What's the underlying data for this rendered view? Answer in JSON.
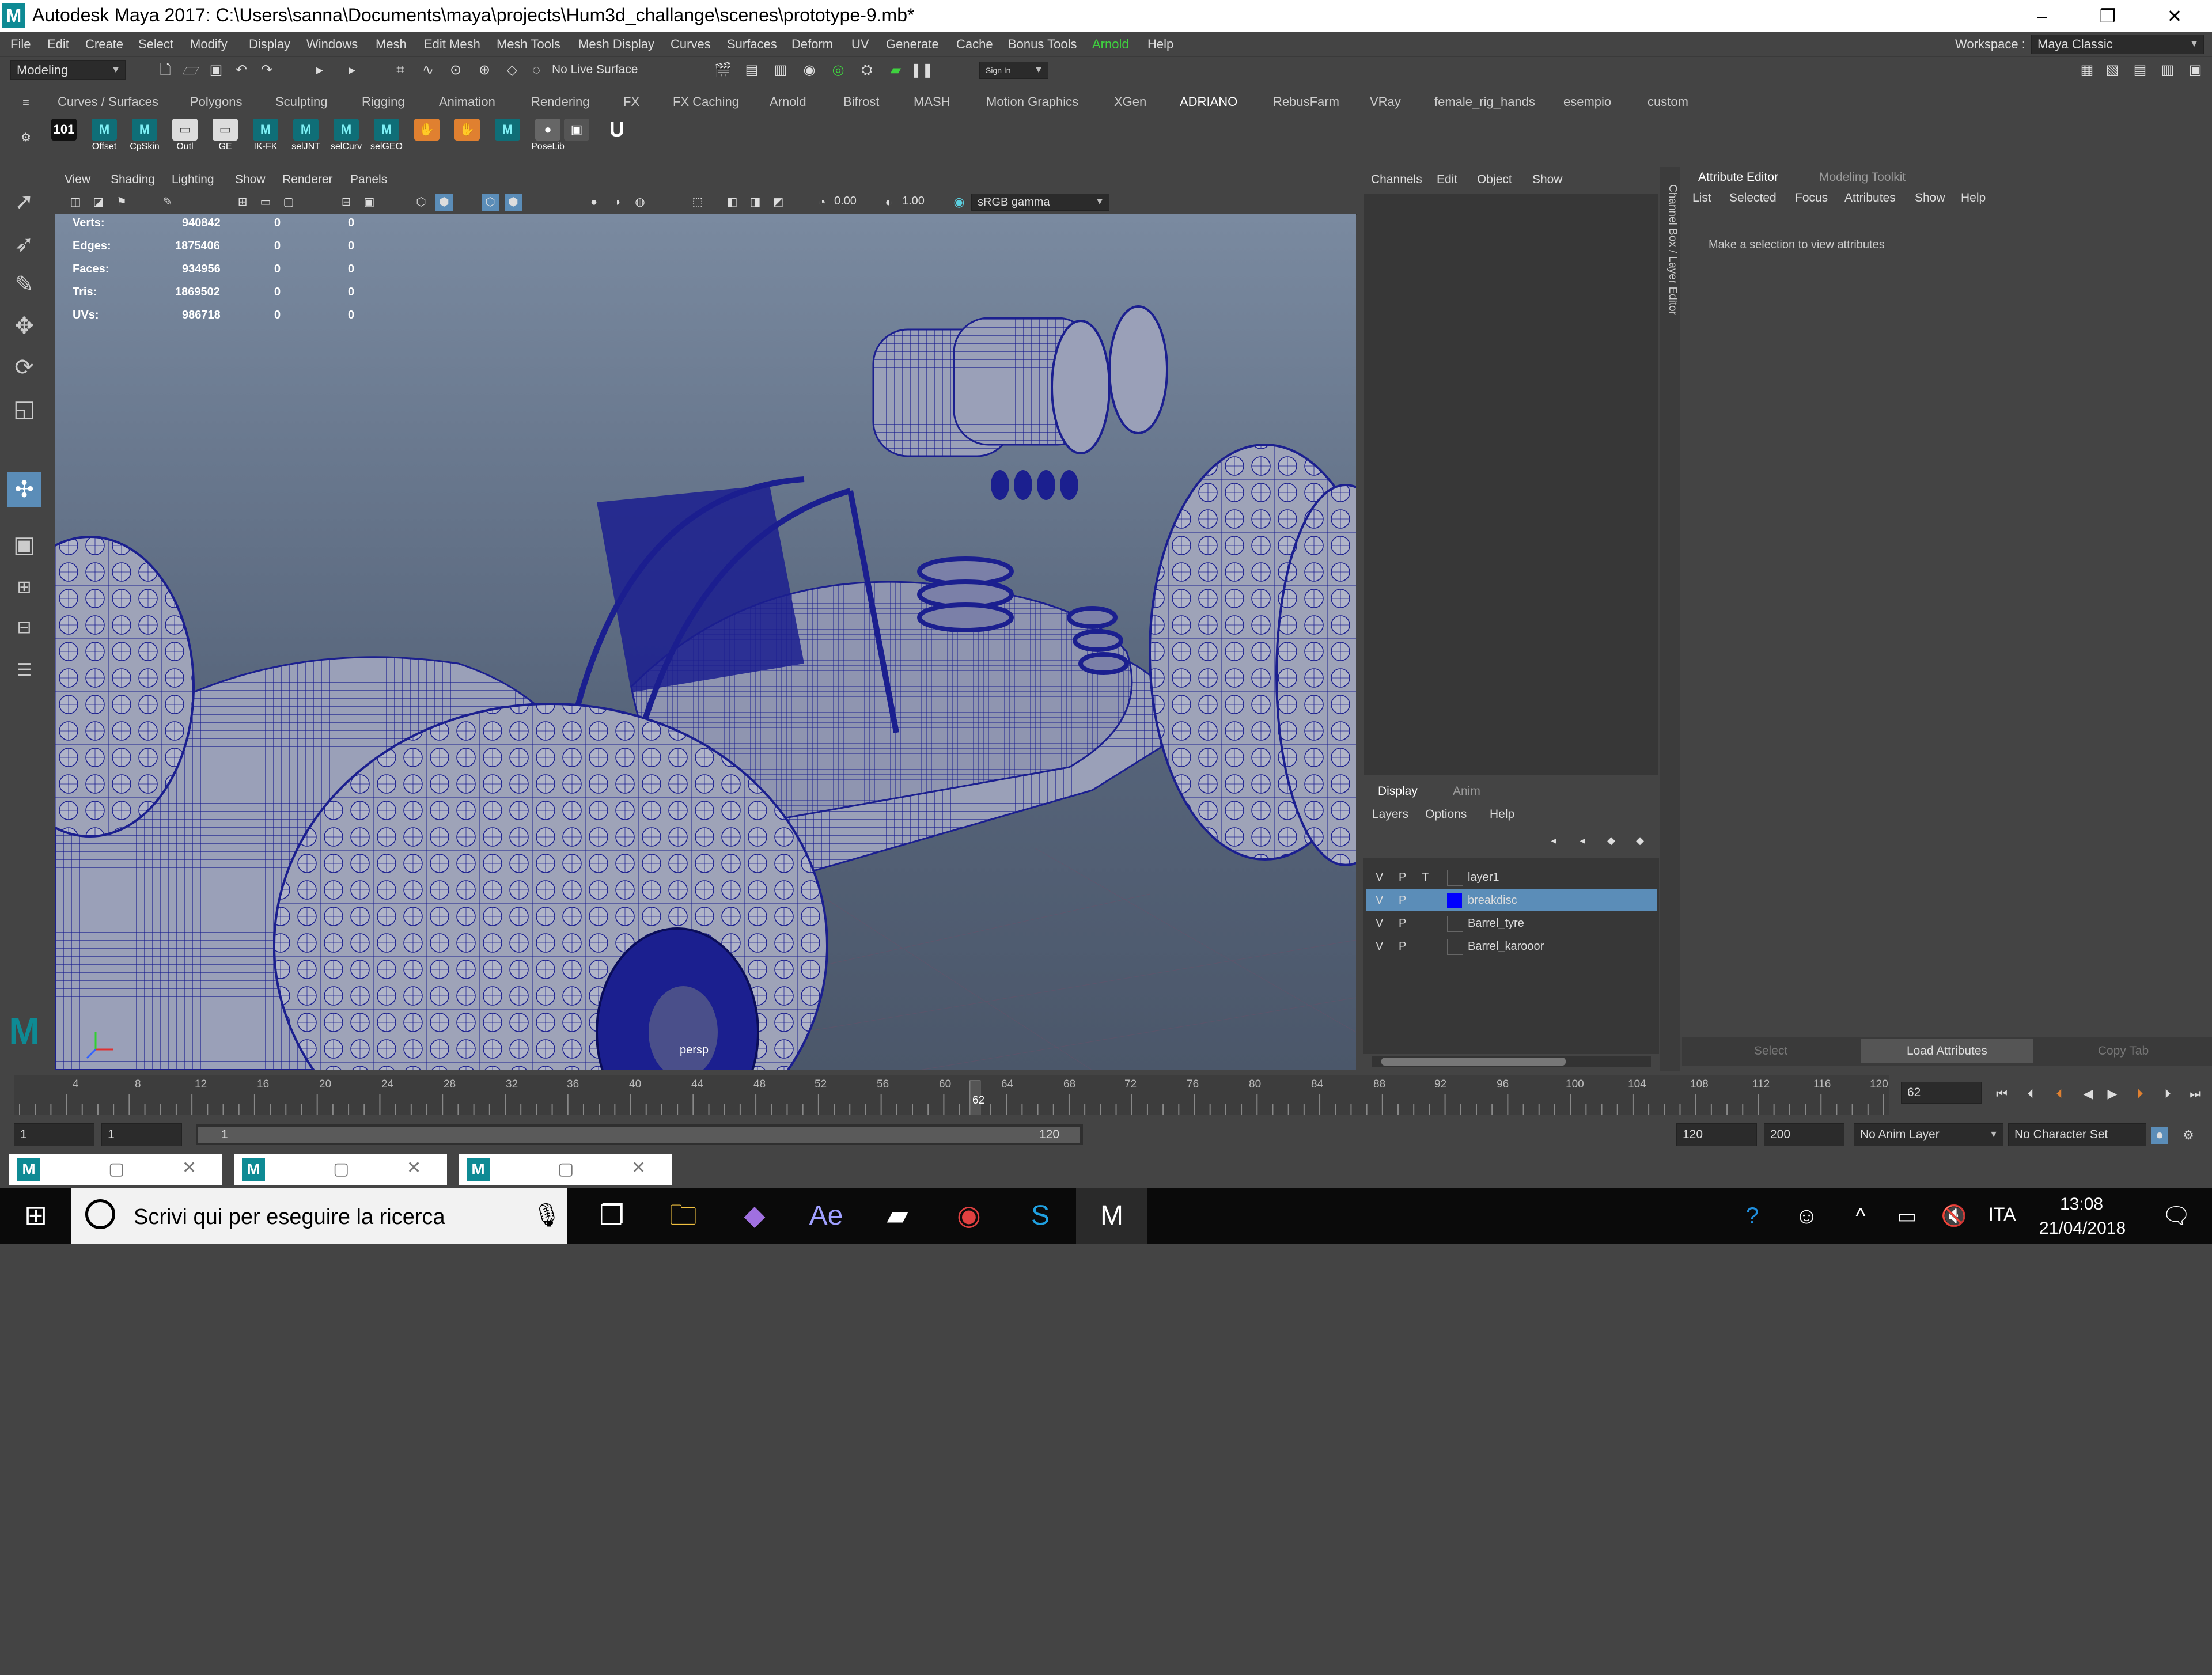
{
  "window": {
    "logo": "M",
    "title": "Autodesk Maya 2017: C:\\Users\\sanna\\Documents\\maya\\projects\\Hum3d_challange\\scenes\\prototype-9.mb*",
    "minimize": "–",
    "maximize": "❐",
    "close": "✕"
  },
  "menubar": {
    "items": [
      "File",
      "Edit",
      "Create",
      "Select",
      "Modify",
      "Display",
      "Windows",
      "Mesh",
      "Edit Mesh",
      "Mesh Tools",
      "Mesh Display",
      "Curves",
      "Surfaces",
      "Deform",
      "UV",
      "Generate",
      "Cache",
      "Bonus Tools",
      "Arnold",
      "Help"
    ],
    "workspace_label": "Workspace :",
    "workspace_value": "Maya Classic"
  },
  "statusline": {
    "mode": "Modeling",
    "live_surface": "No Live Surface",
    "sign_in": "Sign In"
  },
  "shelf": {
    "tabs": [
      "Curves / Surfaces",
      "Polygons",
      "Sculpting",
      "Rigging",
      "Animation",
      "Rendering",
      "FX",
      "FX Caching",
      "Arnold",
      "Bifrost",
      "MASH",
      "Motion Graphics",
      "XGen",
      "ADRIANO",
      "RebusFarm",
      "VRay",
      "female_rig_hands",
      "esempio",
      "custom"
    ],
    "active_tab": "ADRIANO",
    "buttons": [
      "",
      "Offset",
      "CpSkin",
      "Outl",
      "GE",
      "IK-FK",
      "selJNT",
      "selCurv",
      "selGEO",
      "",
      "",
      "",
      "",
      "PoseLib",
      ""
    ]
  },
  "viewport": {
    "menu": [
      "View",
      "Shading",
      "Lighting",
      "Show",
      "Renderer",
      "Panels"
    ],
    "exposure": "0.00",
    "gamma": "1.00",
    "colorspace": "sRGB gamma",
    "camera_label": "persp",
    "hud": [
      {
        "label": "Verts:",
        "v1": "940842",
        "v2": "0",
        "v3": "0"
      },
      {
        "label": "Edges:",
        "v1": "1875406",
        "v2": "0",
        "v3": "0"
      },
      {
        "label": "Faces:",
        "v1": "934956",
        "v2": "0",
        "v3": "0"
      },
      {
        "label": "Tris:",
        "v1": "1869502",
        "v2": "0",
        "v3": "0"
      },
      {
        "label": "UVs:",
        "v1": "986718",
        "v2": "0",
        "v3": "0"
      }
    ]
  },
  "channelbox": {
    "menu": [
      "Channels",
      "Edit",
      "Object",
      "Show"
    ],
    "strip_label": "Channel Box / Layer Editor",
    "layer_tabs": [
      "Display",
      "Anim"
    ],
    "layer_menu": [
      "Layers",
      "Options",
      "Help"
    ],
    "layers": [
      {
        "v": "V",
        "p": "P",
        "t": "T",
        "name": "layer1",
        "color": "",
        "selected": false
      },
      {
        "v": "V",
        "p": "P",
        "t": "",
        "name": "breakdisc",
        "color": "#0000ff",
        "selected": true
      },
      {
        "v": "V",
        "p": "P",
        "t": "",
        "name": "Barrel_tyre",
        "color": "",
        "selected": false
      },
      {
        "v": "V",
        "p": "P",
        "t": "",
        "name": "Barrel_karooor",
        "color": "",
        "selected": false
      }
    ]
  },
  "attribute_editor": {
    "tabs": [
      "Attribute Editor",
      "Modeling Toolkit"
    ],
    "menu": [
      "List",
      "Selected",
      "Focus",
      "Attributes",
      "Show",
      "Help"
    ],
    "message": "Make a selection to view attributes",
    "buttons": [
      "Select",
      "Load Attributes",
      "Copy Tab"
    ]
  },
  "timeslider": {
    "ticks": [
      "4",
      "8",
      "12",
      "16",
      "20",
      "24",
      "28",
      "32",
      "36",
      "40",
      "44",
      "48",
      "52",
      "56",
      "60",
      "64",
      "68",
      "72",
      "76",
      "80",
      "84",
      "88",
      "92",
      "96",
      "100",
      "104",
      "108",
      "112",
      "116",
      "120"
    ],
    "current_frame": "62",
    "current_frame_field": "62"
  },
  "rangeslider": {
    "start": "1",
    "start2": "1",
    "range_start": "1",
    "range_end": "120",
    "end": "120",
    "end2": "200",
    "anim_layer": "No Anim Layer",
    "character_set": "No Character Set"
  },
  "taskbar": {
    "search_placeholder": "Scrivi qui per eseguire la ricerca",
    "language": "ITA",
    "time": "13:08",
    "date": "21/04/2018"
  },
  "colors": {
    "accent": "#5b8db8",
    "arnold": "#3fd23f",
    "maya_teal": "#0e8a94",
    "wire": "#1b1f8f"
  }
}
